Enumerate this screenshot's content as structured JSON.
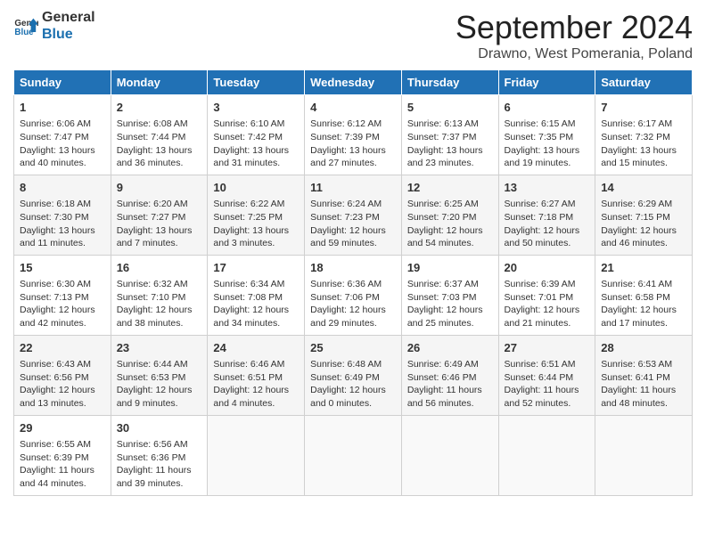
{
  "logo": {
    "line1": "General",
    "line2": "Blue"
  },
  "title": "September 2024",
  "subtitle": "Drawno, West Pomerania, Poland",
  "weekdays": [
    "Sunday",
    "Monday",
    "Tuesday",
    "Wednesday",
    "Thursday",
    "Friday",
    "Saturday"
  ],
  "weeks": [
    [
      {
        "day": "1",
        "info": "Sunrise: 6:06 AM\nSunset: 7:47 PM\nDaylight: 13 hours\nand 40 minutes."
      },
      {
        "day": "2",
        "info": "Sunrise: 6:08 AM\nSunset: 7:44 PM\nDaylight: 13 hours\nand 36 minutes."
      },
      {
        "day": "3",
        "info": "Sunrise: 6:10 AM\nSunset: 7:42 PM\nDaylight: 13 hours\nand 31 minutes."
      },
      {
        "day": "4",
        "info": "Sunrise: 6:12 AM\nSunset: 7:39 PM\nDaylight: 13 hours\nand 27 minutes."
      },
      {
        "day": "5",
        "info": "Sunrise: 6:13 AM\nSunset: 7:37 PM\nDaylight: 13 hours\nand 23 minutes."
      },
      {
        "day": "6",
        "info": "Sunrise: 6:15 AM\nSunset: 7:35 PM\nDaylight: 13 hours\nand 19 minutes."
      },
      {
        "day": "7",
        "info": "Sunrise: 6:17 AM\nSunset: 7:32 PM\nDaylight: 13 hours\nand 15 minutes."
      }
    ],
    [
      {
        "day": "8",
        "info": "Sunrise: 6:18 AM\nSunset: 7:30 PM\nDaylight: 13 hours\nand 11 minutes."
      },
      {
        "day": "9",
        "info": "Sunrise: 6:20 AM\nSunset: 7:27 PM\nDaylight: 13 hours\nand 7 minutes."
      },
      {
        "day": "10",
        "info": "Sunrise: 6:22 AM\nSunset: 7:25 PM\nDaylight: 13 hours\nand 3 minutes."
      },
      {
        "day": "11",
        "info": "Sunrise: 6:24 AM\nSunset: 7:23 PM\nDaylight: 12 hours\nand 59 minutes."
      },
      {
        "day": "12",
        "info": "Sunrise: 6:25 AM\nSunset: 7:20 PM\nDaylight: 12 hours\nand 54 minutes."
      },
      {
        "day": "13",
        "info": "Sunrise: 6:27 AM\nSunset: 7:18 PM\nDaylight: 12 hours\nand 50 minutes."
      },
      {
        "day": "14",
        "info": "Sunrise: 6:29 AM\nSunset: 7:15 PM\nDaylight: 12 hours\nand 46 minutes."
      }
    ],
    [
      {
        "day": "15",
        "info": "Sunrise: 6:30 AM\nSunset: 7:13 PM\nDaylight: 12 hours\nand 42 minutes."
      },
      {
        "day": "16",
        "info": "Sunrise: 6:32 AM\nSunset: 7:10 PM\nDaylight: 12 hours\nand 38 minutes."
      },
      {
        "day": "17",
        "info": "Sunrise: 6:34 AM\nSunset: 7:08 PM\nDaylight: 12 hours\nand 34 minutes."
      },
      {
        "day": "18",
        "info": "Sunrise: 6:36 AM\nSunset: 7:06 PM\nDaylight: 12 hours\nand 29 minutes."
      },
      {
        "day": "19",
        "info": "Sunrise: 6:37 AM\nSunset: 7:03 PM\nDaylight: 12 hours\nand 25 minutes."
      },
      {
        "day": "20",
        "info": "Sunrise: 6:39 AM\nSunset: 7:01 PM\nDaylight: 12 hours\nand 21 minutes."
      },
      {
        "day": "21",
        "info": "Sunrise: 6:41 AM\nSunset: 6:58 PM\nDaylight: 12 hours\nand 17 minutes."
      }
    ],
    [
      {
        "day": "22",
        "info": "Sunrise: 6:43 AM\nSunset: 6:56 PM\nDaylight: 12 hours\nand 13 minutes."
      },
      {
        "day": "23",
        "info": "Sunrise: 6:44 AM\nSunset: 6:53 PM\nDaylight: 12 hours\nand 9 minutes."
      },
      {
        "day": "24",
        "info": "Sunrise: 6:46 AM\nSunset: 6:51 PM\nDaylight: 12 hours\nand 4 minutes."
      },
      {
        "day": "25",
        "info": "Sunrise: 6:48 AM\nSunset: 6:49 PM\nDaylight: 12 hours\nand 0 minutes."
      },
      {
        "day": "26",
        "info": "Sunrise: 6:49 AM\nSunset: 6:46 PM\nDaylight: 11 hours\nand 56 minutes."
      },
      {
        "day": "27",
        "info": "Sunrise: 6:51 AM\nSunset: 6:44 PM\nDaylight: 11 hours\nand 52 minutes."
      },
      {
        "day": "28",
        "info": "Sunrise: 6:53 AM\nSunset: 6:41 PM\nDaylight: 11 hours\nand 48 minutes."
      }
    ],
    [
      {
        "day": "29",
        "info": "Sunrise: 6:55 AM\nSunset: 6:39 PM\nDaylight: 11 hours\nand 44 minutes."
      },
      {
        "day": "30",
        "info": "Sunrise: 6:56 AM\nSunset: 6:36 PM\nDaylight: 11 hours\nand 39 minutes."
      },
      {
        "day": "",
        "info": ""
      },
      {
        "day": "",
        "info": ""
      },
      {
        "day": "",
        "info": ""
      },
      {
        "day": "",
        "info": ""
      },
      {
        "day": "",
        "info": ""
      }
    ]
  ]
}
